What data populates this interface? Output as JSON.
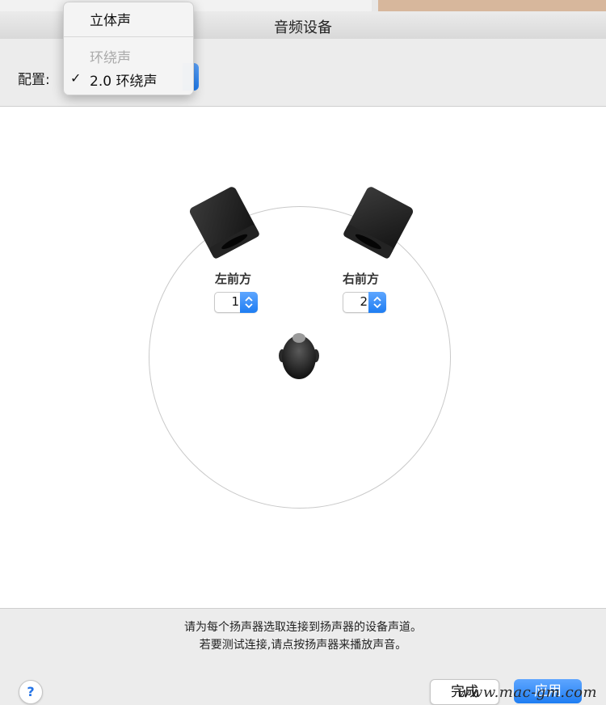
{
  "window": {
    "title": "音频设备"
  },
  "config": {
    "label": "配置:",
    "menu": {
      "items": [
        {
          "label": "立体声",
          "enabled": true,
          "checked": false
        },
        {
          "label": "环绕声",
          "enabled": false,
          "checked": false
        },
        {
          "label": "2.0 环绕声",
          "enabled": true,
          "checked": true
        }
      ],
      "check_mark": "✓"
    }
  },
  "speakers": {
    "left": {
      "label": "左前方",
      "channel": "1"
    },
    "right": {
      "label": "右前方",
      "channel": "2"
    }
  },
  "instructions": {
    "line1": "请为每个扬声器选取连接到扬声器的设备声道。",
    "line2": "若要测试连接,请点按扬声器来播放声音。"
  },
  "buttons": {
    "help": "?",
    "done": "完成",
    "apply": "应用"
  },
  "watermark": "www.mac-gm.com",
  "colors": {
    "accent": "#1e7df2",
    "speaker": "#1f1f1f"
  }
}
